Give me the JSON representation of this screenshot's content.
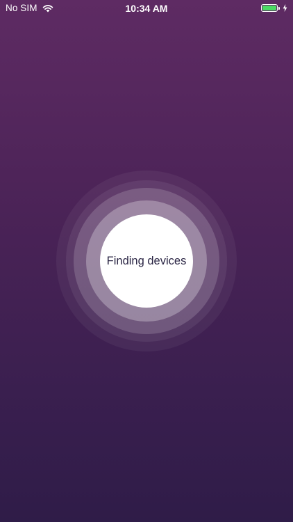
{
  "status_bar": {
    "carrier": "No SIM",
    "time": "10:34 AM",
    "battery_level": 1.0,
    "battery_color": "#4cd964",
    "icons": [
      "wifi-icon",
      "battery-icon",
      "charging-icon"
    ]
  },
  "scan": {
    "label": "Finding devices"
  },
  "colors": {
    "background_top": "#5e2b63",
    "background_bottom": "#2f1c48",
    "label_text": "#2a2544"
  }
}
